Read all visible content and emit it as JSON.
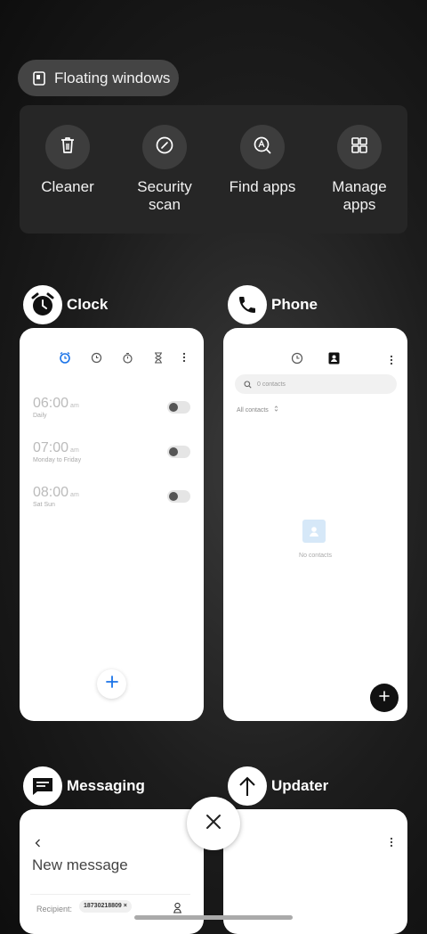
{
  "floating_windows": {
    "label": "Floating windows",
    "icon": "floating-window-icon"
  },
  "tools": [
    {
      "label": "Cleaner",
      "icon": "trash-icon"
    },
    {
      "label": "Security scan",
      "icon": "scan-icon"
    },
    {
      "label": "Find apps",
      "icon": "find-apps-icon"
    },
    {
      "label": "Manage apps",
      "icon": "grid-icon"
    }
  ],
  "apps": {
    "clock": {
      "name": "Clock",
      "alarms": [
        {
          "time": "06:00",
          "period": "am",
          "repeat": "Daily"
        },
        {
          "time": "07:00",
          "period": "am",
          "repeat": "Monday to Friday"
        },
        {
          "time": "08:00",
          "period": "am",
          "repeat": "Sat Sun"
        }
      ]
    },
    "phone": {
      "name": "Phone",
      "search_placeholder": "0 contacts",
      "filter": "All contacts",
      "empty_text": "No contacts"
    },
    "messaging": {
      "name": "Messaging",
      "title": "New message",
      "recipient_label": "Recipient:",
      "recipient_chip": "18730218809"
    },
    "updater": {
      "name": "Updater"
    }
  },
  "colors": {
    "accent_blue": "#1a73e8",
    "tool_bg": "#3d3d3d"
  }
}
